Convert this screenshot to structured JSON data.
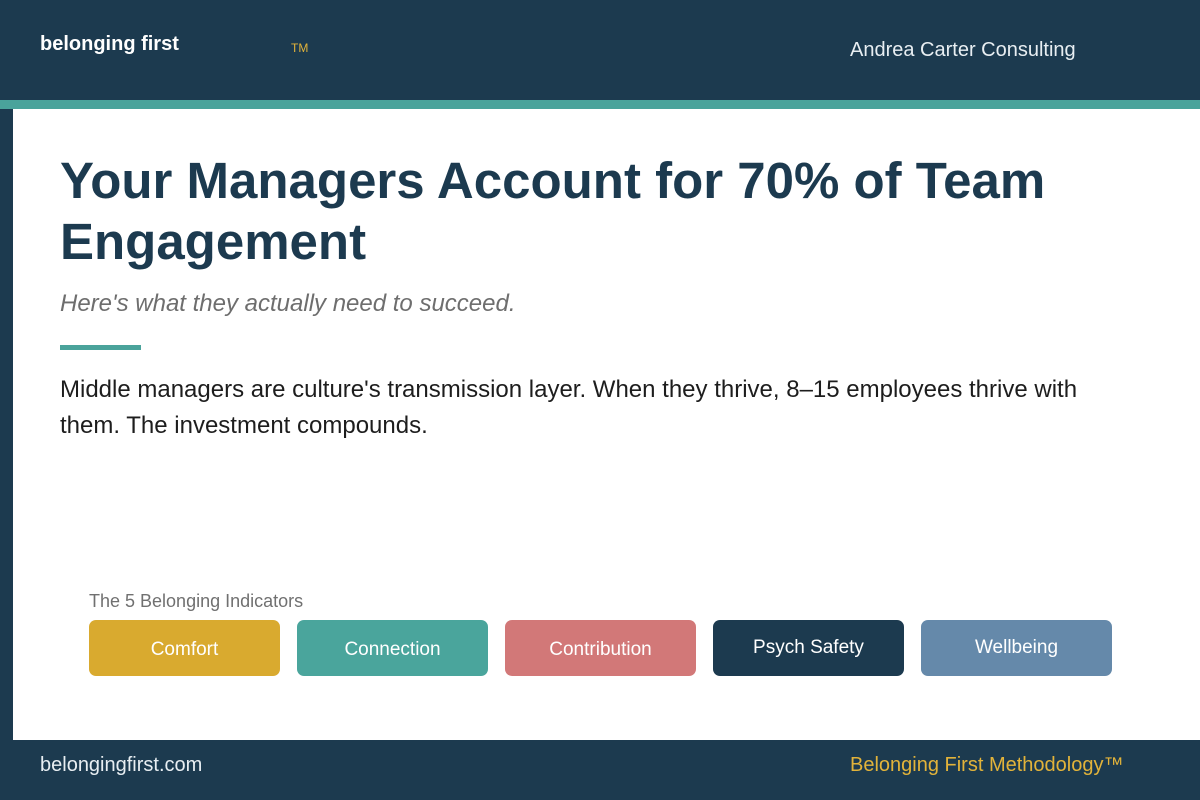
{
  "header": {
    "brand": "belonging first",
    "trademark": "TM",
    "organization": "Andrea Carter Consulting"
  },
  "main": {
    "title": "Your Managers Account for 70% of Team Engagement",
    "subtitle": "Here's what they actually need to succeed.",
    "body": "Middle managers are culture's transmission layer. When they thrive, 8–15 employees thrive with them. The investment compounds."
  },
  "indicators": {
    "heading": "The 5 Belonging Indicators",
    "items": [
      {
        "label": "Comfort",
        "color": "#d9aa2f"
      },
      {
        "label": "Connection",
        "color": "#4aa59c"
      },
      {
        "label": "Contribution",
        "color": "#d27878"
      },
      {
        "label": "Psych Safety",
        "color": "#1c3a4f"
      },
      {
        "label": "Wellbeing",
        "color": "#6589aa"
      }
    ]
  },
  "footer": {
    "website": "belongingfirst.com",
    "methodology": "Belonging First Methodology™"
  },
  "colors": {
    "navy": "#1c3a4f",
    "teal": "#4aa39b",
    "gold": "#e2b33a"
  }
}
